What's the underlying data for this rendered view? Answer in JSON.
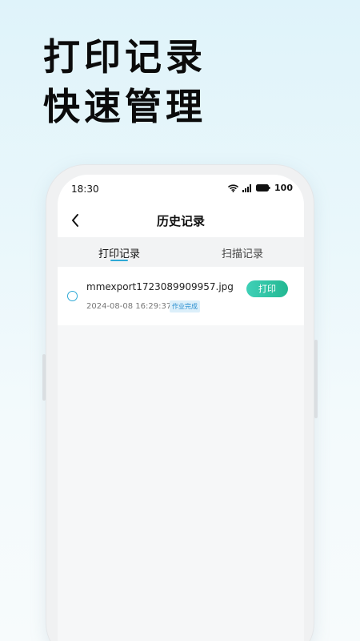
{
  "promo": {
    "line1": "打印记录",
    "line2": "快速管理"
  },
  "status_bar": {
    "time": "18:30",
    "battery": "100",
    "icons": [
      "wifi-icon",
      "signal-icon",
      "battery-icon"
    ]
  },
  "nav": {
    "title": "历史记录",
    "back_icon": "chevron-left-icon"
  },
  "tabs": [
    {
      "label": "打印记录",
      "active": true
    },
    {
      "label": "扫描记录",
      "active": false
    }
  ],
  "records": [
    {
      "file_name": "mmexport1723089909957.jpg",
      "time": "2024-08-08 16:29:37",
      "status": "作业完成",
      "action_label": "打印"
    }
  ],
  "colors": {
    "accent": "#2ea9d6",
    "print_button": "#23b892",
    "status_tag_text": "#2b8fd0",
    "status_tag_bg": "#dceffa"
  }
}
